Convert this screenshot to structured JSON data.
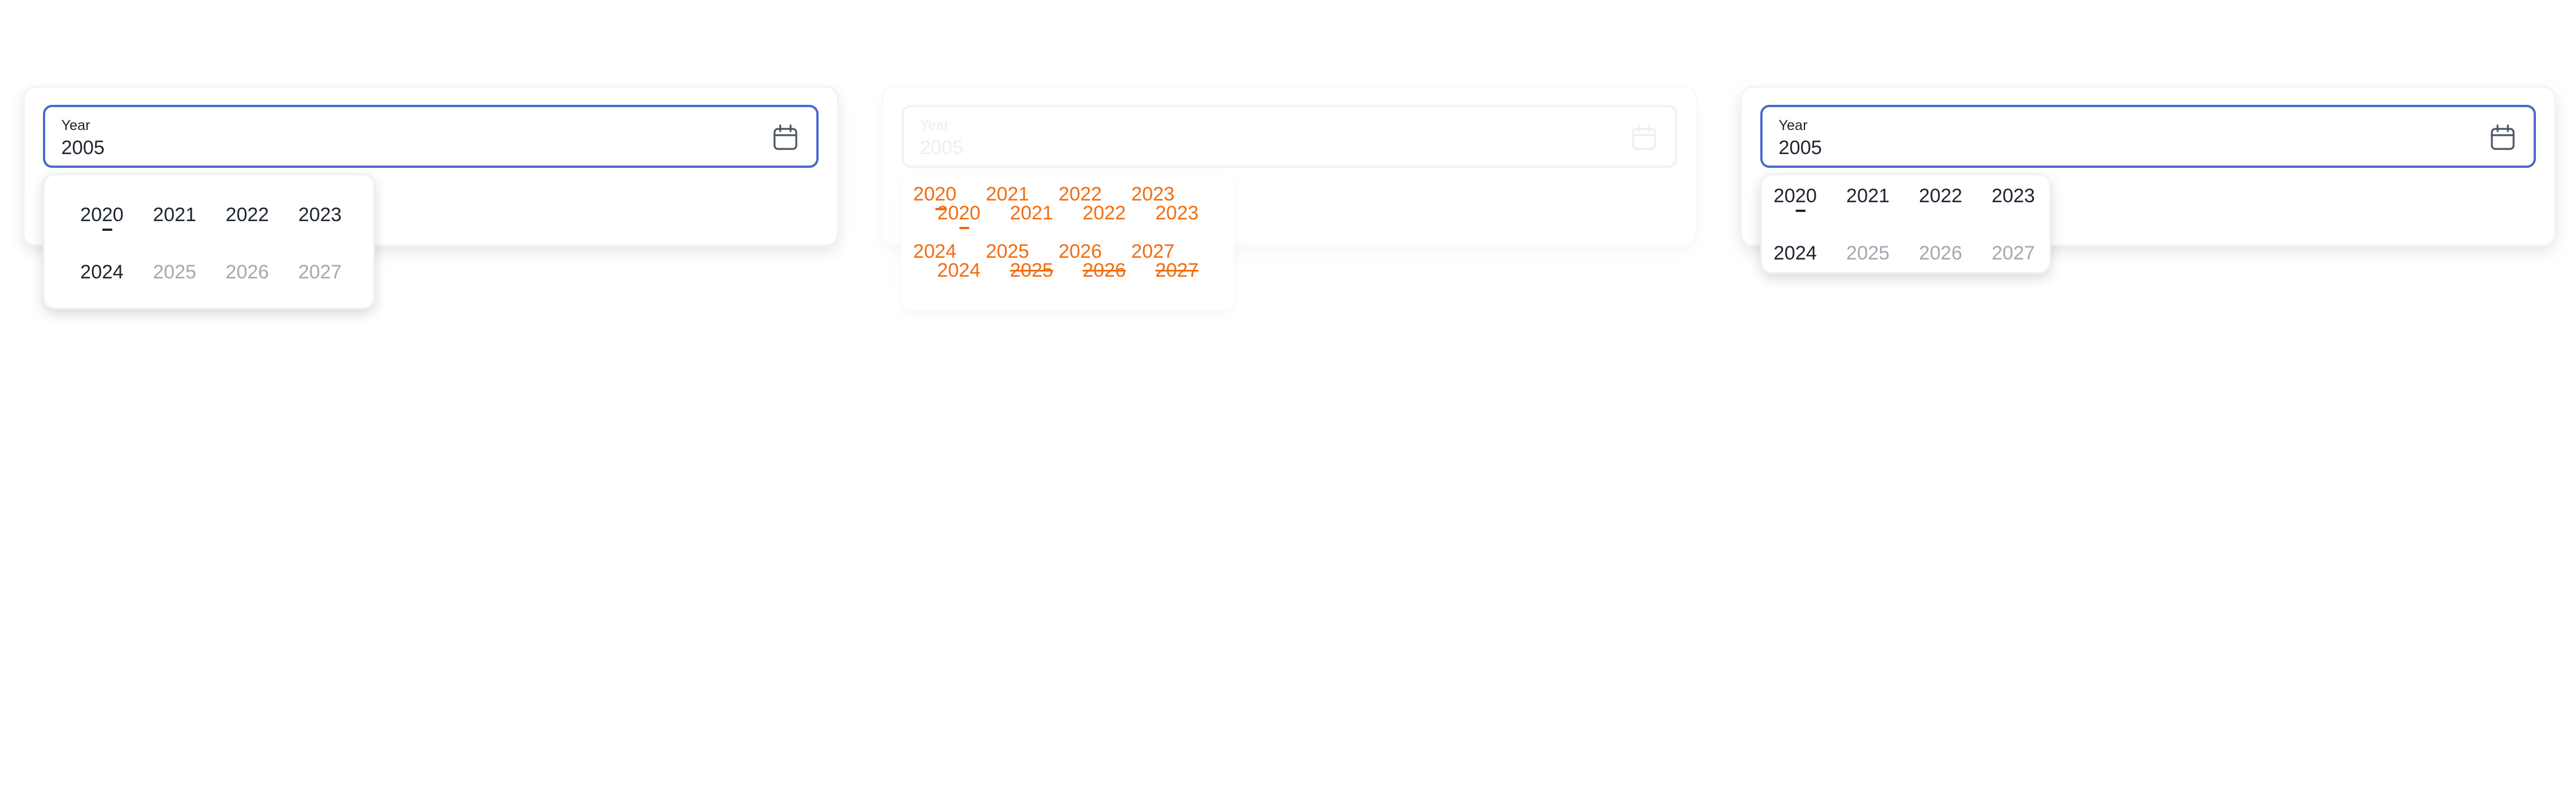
{
  "field_label": "Year",
  "field_value": "2005",
  "years": [
    "2020",
    "2021",
    "2022",
    "2023",
    "2024",
    "2025",
    "2026",
    "2027"
  ],
  "enabled_years": [
    "2020",
    "2021",
    "2022",
    "2023",
    "2024"
  ],
  "disabled_years": [
    "2025",
    "2026",
    "2027"
  ],
  "colors": {
    "field_border": "#4a6bc9",
    "text": "#1e2430",
    "muted_text": "#a3a8b1",
    "diff_highlight": "#f26c0d"
  }
}
